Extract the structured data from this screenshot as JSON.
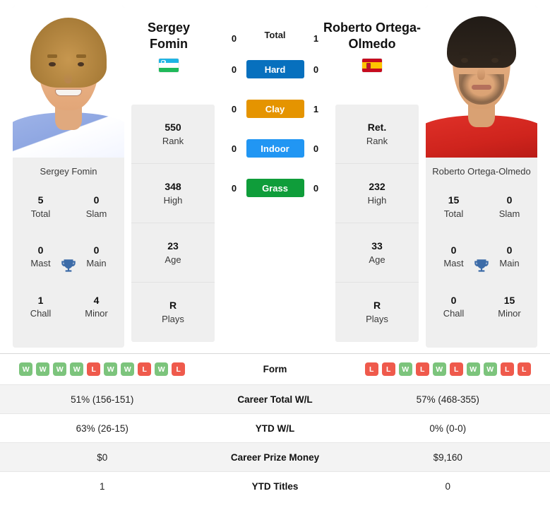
{
  "players": {
    "left": {
      "name_header": "Sergey Fomin",
      "photo_caption": "Sergey Fomin",
      "flag": "uzbekistan-flag",
      "titles": [
        {
          "num": "5",
          "label": "Total"
        },
        {
          "num": "0",
          "label": "Slam"
        },
        {
          "num": "0",
          "label": "Mast"
        },
        {
          "num": "0",
          "label": "Main"
        },
        {
          "num": "1",
          "label": "Chall"
        },
        {
          "num": "4",
          "label": "Minor"
        }
      ],
      "stats": [
        {
          "num": "550",
          "label": "Rank"
        },
        {
          "num": "348",
          "label": "High"
        },
        {
          "num": "23",
          "label": "Age"
        },
        {
          "num": "R",
          "label": "Plays"
        }
      ],
      "form": [
        "W",
        "W",
        "W",
        "W",
        "L",
        "W",
        "W",
        "L",
        "W",
        "L"
      ],
      "career_total_wl": "51% (156-151)",
      "ytd_wl": "63% (26-15)",
      "career_prize_money": "$0",
      "ytd_titles": "1"
    },
    "right": {
      "name_header": "Roberto Ortega-Olmedo",
      "photo_caption": "Roberto Ortega-Olmedo",
      "flag": "spain-flag",
      "titles": [
        {
          "num": "15",
          "label": "Total"
        },
        {
          "num": "0",
          "label": "Slam"
        },
        {
          "num": "0",
          "label": "Mast"
        },
        {
          "num": "0",
          "label": "Main"
        },
        {
          "num": "0",
          "label": "Chall"
        },
        {
          "num": "15",
          "label": "Minor"
        }
      ],
      "stats": [
        {
          "num": "Ret.",
          "label": "Rank"
        },
        {
          "num": "232",
          "label": "High"
        },
        {
          "num": "33",
          "label": "Age"
        },
        {
          "num": "R",
          "label": "Plays"
        }
      ],
      "form": [
        "L",
        "L",
        "W",
        "L",
        "W",
        "L",
        "W",
        "W",
        "L",
        "L"
      ],
      "career_total_wl": "57% (468-355)",
      "ytd_wl": "0% (0-0)",
      "career_prize_money": "$9,160",
      "ytd_titles": "0"
    }
  },
  "head_to_head": [
    {
      "surface": "Total",
      "left": "0",
      "right": "1",
      "color": "none"
    },
    {
      "surface": "Hard",
      "left": "0",
      "right": "0",
      "color": "#0770be"
    },
    {
      "surface": "Clay",
      "left": "0",
      "right": "1",
      "color": "#e59400"
    },
    {
      "surface": "Indoor",
      "left": "0",
      "right": "0",
      "color": "#2196f3"
    },
    {
      "surface": "Grass",
      "left": "0",
      "right": "0",
      "color": "#0f9d3a"
    }
  ],
  "table_rows": [
    {
      "label": "Form",
      "type": "form"
    },
    {
      "label": "Career Total W/L",
      "type": "text",
      "key": "career_total_wl"
    },
    {
      "label": "YTD W/L",
      "type": "text",
      "key": "ytd_wl"
    },
    {
      "label": "Career Prize Money",
      "type": "text",
      "key": "career_prize_money"
    },
    {
      "label": "YTD Titles",
      "type": "text",
      "key": "ytd_titles"
    }
  ],
  "colors": {
    "hard": "#0770be",
    "clay": "#e59400",
    "indoor": "#2196f3",
    "grass": "#0f9d3a",
    "win_badge": "#7cc47c",
    "loss_badge": "#ef5a4c",
    "card_bg": "#efefef",
    "trophy": "#3d6ca8"
  }
}
